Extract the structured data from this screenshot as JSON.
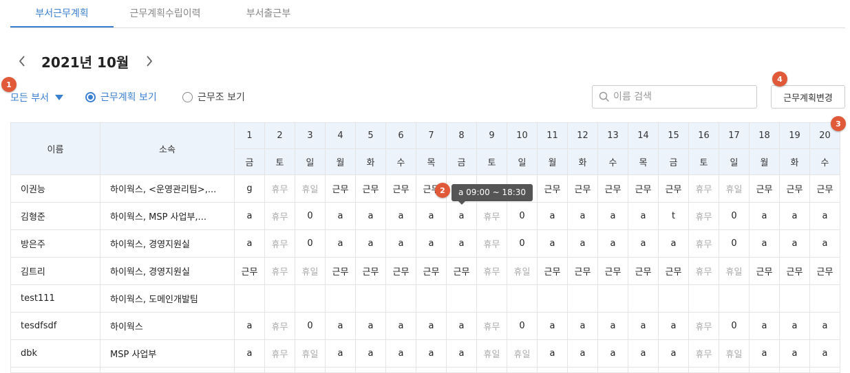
{
  "tabs": [
    {
      "label": "부서근무계획",
      "active": true
    },
    {
      "label": "근무계획수립이력",
      "active": false
    },
    {
      "label": "부서출근부",
      "active": false
    }
  ],
  "month_nav": {
    "title": "2021년 10월",
    "prev_icon": "chevron-left-icon",
    "next_icon": "chevron-right-icon"
  },
  "badges": [
    "1",
    "2",
    "3",
    "4"
  ],
  "filters": {
    "dept_select": "모든 부서",
    "radio_plan": "근무계획 보기",
    "radio_group": "근무조 보기",
    "selected": "plan"
  },
  "search": {
    "placeholder": "이름 검색",
    "value": ""
  },
  "change_button": "근무계획변경",
  "tooltip": "a 09:00 ~ 18:30",
  "colors": {
    "accent": "#3b7fd0",
    "badge": "#e05a3a",
    "header_bg": "#edf3fb",
    "off_text": "#aaaaaa"
  },
  "table": {
    "headers": {
      "name": "이름",
      "dept": "소속"
    },
    "days": [
      "1",
      "2",
      "3",
      "4",
      "5",
      "6",
      "7",
      "8",
      "9",
      "10",
      "11",
      "12",
      "13",
      "14",
      "15",
      "16",
      "17",
      "18",
      "19",
      "20"
    ],
    "weekdays": [
      "금",
      "토",
      "일",
      "월",
      "화",
      "수",
      "목",
      "금",
      "토",
      "일",
      "월",
      "화",
      "수",
      "목",
      "금",
      "토",
      "일",
      "월",
      "화",
      "수"
    ],
    "rows": [
      {
        "name": "이권능",
        "dept": "하이웍스, <운영관리팀>,...",
        "cells": [
          "g",
          "휴무",
          "휴일",
          "근무",
          "근무",
          "근무",
          "근무",
          "",
          "",
          "",
          "근무",
          "근무",
          "근무",
          "근무",
          "근무",
          "휴무",
          "휴일",
          "근무",
          "근무",
          "근무"
        ]
      },
      {
        "name": "김형준",
        "dept": "하이웍스, MSP 사업부,...",
        "cells": [
          "a",
          "휴무",
          "0",
          "a",
          "a",
          "a",
          "a",
          "a",
          "휴무",
          "0",
          "a",
          "a",
          "a",
          "a",
          "t",
          "휴무",
          "0",
          "a",
          "a",
          "a"
        ]
      },
      {
        "name": "방은주",
        "dept": "하이웍스, 경영지원실",
        "cells": [
          "a",
          "휴무",
          "0",
          "a",
          "a",
          "a",
          "a",
          "a",
          "휴무",
          "0",
          "a",
          "a",
          "a",
          "a",
          "a",
          "휴무",
          "0",
          "a",
          "a",
          "a"
        ]
      },
      {
        "name": "김트리",
        "dept": "하이웍스, 경영지원실",
        "cells": [
          "근무",
          "휴무",
          "휴일",
          "근무",
          "근무",
          "근무",
          "근무",
          "근무",
          "휴무",
          "휴일",
          "근무",
          "근무",
          "근무",
          "근무",
          "근무",
          "휴무",
          "휴일",
          "근무",
          "근무",
          "근무"
        ]
      },
      {
        "name": "test111",
        "dept": "하이웍스, 도메인개발팀",
        "cells": [
          "",
          "",
          "",
          "",
          "",
          "",
          "",
          "",
          "",
          "",
          "",
          "",
          "",
          "",
          "",
          "",
          "",
          "",
          "",
          ""
        ]
      },
      {
        "name": "tesdfsdf",
        "dept": "하이웍스",
        "cells": [
          "a",
          "휴무",
          "0",
          "a",
          "a",
          "a",
          "a",
          "a",
          "휴무",
          "0",
          "a",
          "a",
          "a",
          "a",
          "a",
          "휴무",
          "0",
          "a",
          "a",
          "a"
        ]
      },
      {
        "name": "dbk",
        "dept": "MSP 사업부",
        "cells": [
          "a",
          "휴무",
          "휴일",
          "a",
          "a",
          "a",
          "a",
          "a",
          "휴일",
          "휴일",
          "a",
          "a",
          "a",
          "a",
          "a",
          "휴무",
          "휴일",
          "a",
          "a",
          "a"
        ]
      }
    ]
  }
}
